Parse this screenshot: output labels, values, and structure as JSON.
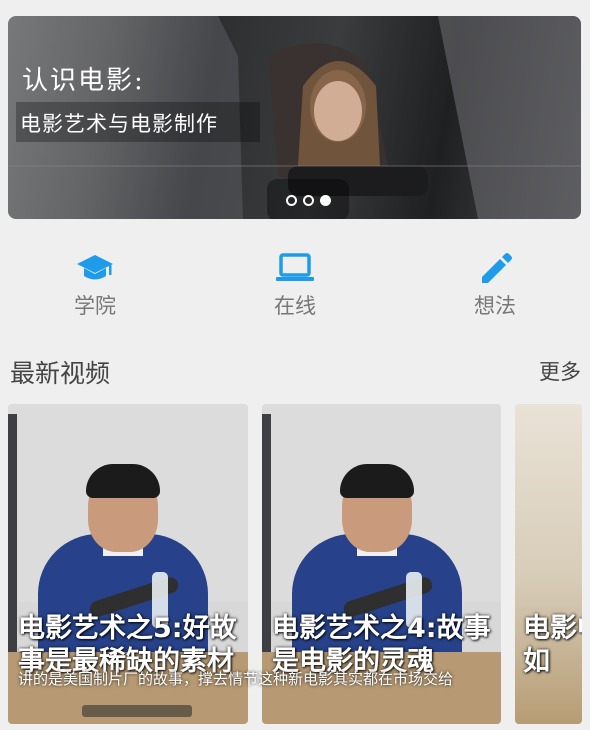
{
  "banner": {
    "title": "认识电影:",
    "subtitle": "电影艺术与电影制作",
    "pager": {
      "count": 3,
      "active_index": 2
    }
  },
  "nav": {
    "items": [
      {
        "label": "学院",
        "icon": "graduation-cap-icon"
      },
      {
        "label": "在线",
        "icon": "laptop-icon"
      },
      {
        "label": "想法",
        "icon": "pencil-icon"
      }
    ],
    "accent_color": "#1e9be9"
  },
  "section": {
    "title": "最新视频",
    "more_label": "更多"
  },
  "videos": [
    {
      "title": "电影艺术之5:好故事是最稀缺的素材"
    },
    {
      "title": "电影艺术之4:故事是电影的灵魂"
    },
    {
      "title": "电影中国是如"
    }
  ],
  "overlay_caption": "讲的是美国制片厂的故事，撑去情节这种新电影其实都在市场交给"
}
